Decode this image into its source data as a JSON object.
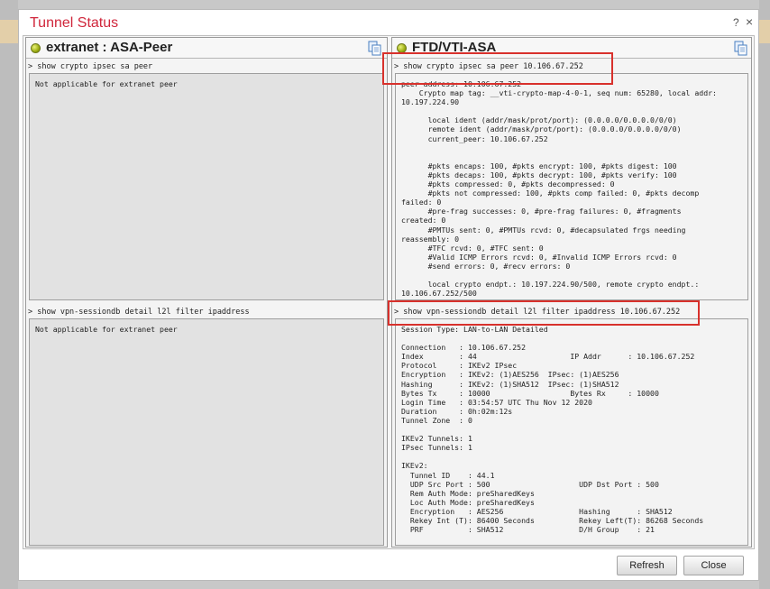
{
  "dialog": {
    "title": "Tunnel Status",
    "help_glyph": "?",
    "close_glyph": "×"
  },
  "peers": {
    "left": {
      "name": "extranet : ASA-Peer",
      "status_color": "#a5b817",
      "ipsec_command": "> show crypto ipsec sa peer",
      "ipsec_output": "Not applicable for extranet peer",
      "session_command": "> show vpn-sessiondb detail l2l filter ipaddress",
      "session_output": "Not applicable for extranet peer"
    },
    "right": {
      "name": "FTD/VTI-ASA",
      "status_color": "#a5b817",
      "ipsec_command": "> show crypto ipsec sa peer 10.106.67.252",
      "ipsec_output": "peer address: 10.106.67.252\n    Crypto map tag: __vti-crypto-map-4-0-1, seq num: 65280, local addr:\n10.197.224.90\n\n      local ident (addr/mask/prot/port): (0.0.0.0/0.0.0.0/0/0)\n      remote ident (addr/mask/prot/port): (0.0.0.0/0.0.0.0/0/0)\n      current_peer: 10.106.67.252\n\n\n      #pkts encaps: 100, #pkts encrypt: 100, #pkts digest: 100\n      #pkts decaps: 100, #pkts decrypt: 100, #pkts verify: 100\n      #pkts compressed: 0, #pkts decompressed: 0\n      #pkts not compressed: 100, #pkts comp failed: 0, #pkts decomp\nfailed: 0\n      #pre-frag successes: 0, #pre-frag failures: 0, #fragments\ncreated: 0\n      #PMTUs sent: 0, #PMTUs rcvd: 0, #decapsulated frgs needing\nreassembly: 0\n      #TFC rcvd: 0, #TFC sent: 0\n      #Valid ICMP Errors rcvd: 0, #Invalid ICMP Errors rcvd: 0\n      #send errors: 0, #recv errors: 0\n\n      local crypto endpt.: 10.197.224.90/500, remote crypto endpt.:\n10.106.67.252/500",
      "session_command": "> show vpn-sessiondb detail l2l filter ipaddress 10.106.67.252",
      "session_output": "Session Type: LAN-to-LAN Detailed\n\nConnection   : 10.106.67.252\nIndex        : 44                     IP Addr      : 10.106.67.252\nProtocol     : IKEv2 IPsec\nEncryption   : IKEv2: (1)AES256  IPsec: (1)AES256\nHashing      : IKEv2: (1)SHA512  IPsec: (1)SHA512\nBytes Tx     : 10000                  Bytes Rx     : 10000\nLogin Time   : 03:54:57 UTC Thu Nov 12 2020\nDuration     : 0h:02m:12s\nTunnel Zone  : 0\n\nIKEv2 Tunnels: 1\nIPsec Tunnels: 1\n\nIKEv2:\n  Tunnel ID    : 44.1\n  UDP Src Port : 500                    UDP Dst Port : 500\n  Rem Auth Mode: preSharedKeys\n  Loc Auth Mode: preSharedKeys\n  Encryption   : AES256                 Hashing      : SHA512\n  Rekey Int (T): 86400 Seconds          Rekey Left(T): 86268 Seconds\n  PRF          : SHA512                 D/H Group    : 21"
    }
  },
  "buttons": {
    "refresh": "Refresh",
    "close": "Close"
  },
  "colors": {
    "title": "#d0263b",
    "highlight": "#d8312c"
  },
  "icons": {
    "copy": "copy-icon",
    "status": "status-led-icon"
  }
}
